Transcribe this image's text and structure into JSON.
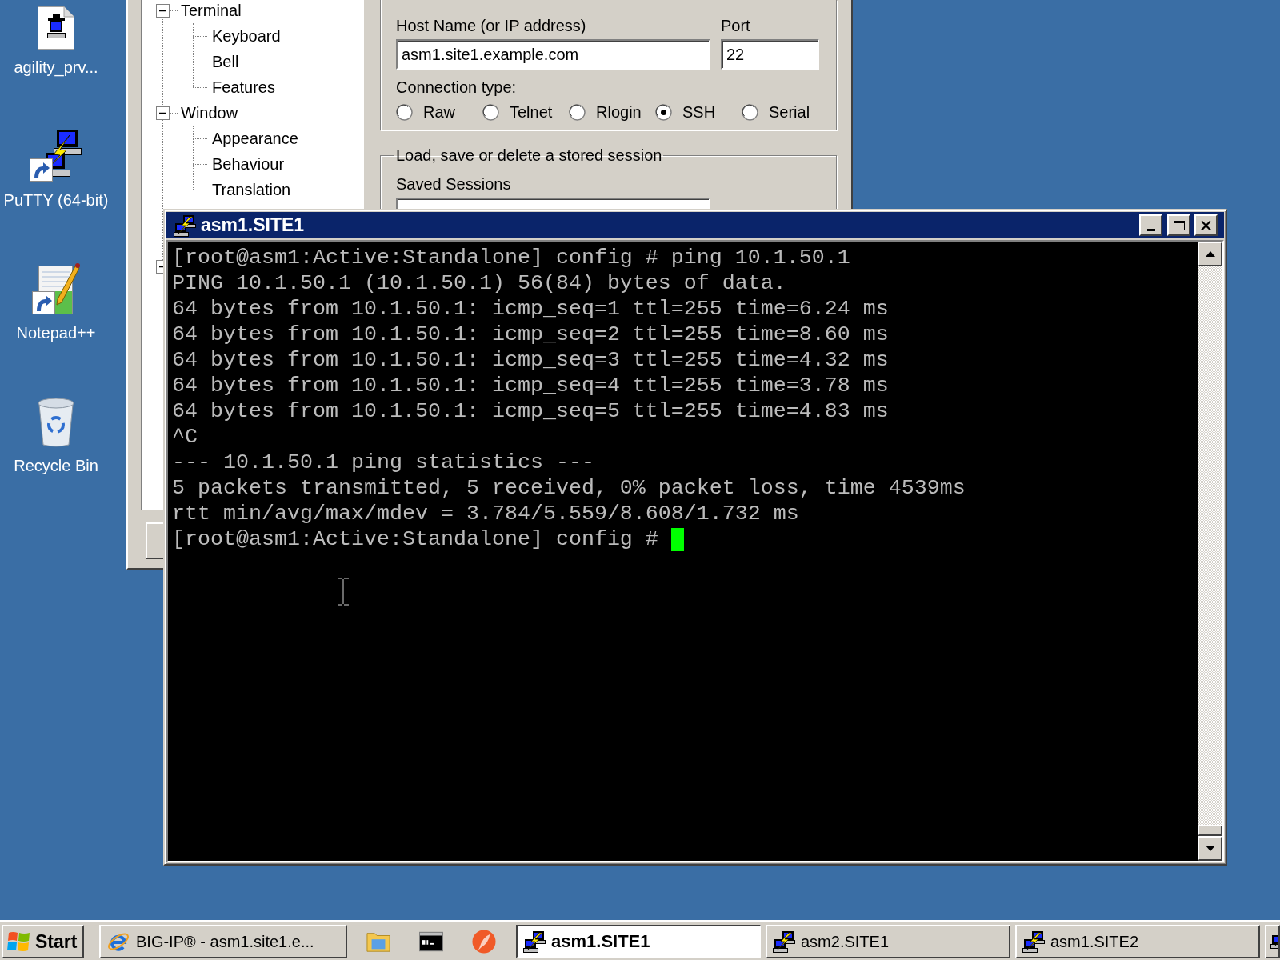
{
  "desktop_icons": [
    {
      "label": "agility_prv...",
      "kind": "document",
      "shortcut": false
    },
    {
      "label": "PuTTY (64-bit)",
      "kind": "terminal",
      "shortcut": true
    },
    {
      "label": "Notepad++",
      "kind": "editor",
      "shortcut": true
    },
    {
      "label": "Recycle Bin",
      "kind": "trash",
      "shortcut": false
    }
  ],
  "config_window": {
    "tree": [
      {
        "label": "Terminal",
        "expanded": true,
        "children": [
          {
            "label": "Keyboard"
          },
          {
            "label": "Bell"
          },
          {
            "label": "Features"
          }
        ]
      },
      {
        "label": "Window",
        "expanded": true,
        "children": [
          {
            "label": "Appearance"
          },
          {
            "label": "Behaviour"
          },
          {
            "label": "Translation"
          }
        ]
      },
      {
        "expanded": true
      }
    ],
    "host_label": "Host Name (or IP address)",
    "host_value": "asm1.site1.example.com",
    "port_label": "Port",
    "port_value": "22",
    "connection_type_label": "Connection type:",
    "connection_types": [
      {
        "label": "Raw",
        "selected": false
      },
      {
        "label": "Telnet",
        "selected": false
      },
      {
        "label": "Rlogin",
        "selected": false
      },
      {
        "label": "SSH",
        "selected": true
      },
      {
        "label": "Serial",
        "selected": false
      }
    ],
    "sessions_group_title": "Load, save or delete a stored session",
    "saved_sessions_label": "Saved Sessions"
  },
  "terminal_window": {
    "title": "asm1.SITE1",
    "lines": [
      "[root@asm1:Active:Standalone] config # ping 10.1.50.1",
      "PING 10.1.50.1 (10.1.50.1) 56(84) bytes of data.",
      "64 bytes from 10.1.50.1: icmp_seq=1 ttl=255 time=6.24 ms",
      "64 bytes from 10.1.50.1: icmp_seq=2 ttl=255 time=8.60 ms",
      "64 bytes from 10.1.50.1: icmp_seq=3 ttl=255 time=4.32 ms",
      "64 bytes from 10.1.50.1: icmp_seq=4 ttl=255 time=3.78 ms",
      "64 bytes from 10.1.50.1: icmp_seq=5 ttl=255 time=4.83 ms",
      "^C",
      "--- 10.1.50.1 ping statistics ---",
      "5 packets transmitted, 5 received, 0% packet loss, time 4539ms",
      "rtt min/avg/max/mdev = 3.784/5.559/8.608/1.732 ms",
      "[root@asm1:Active:Standalone] config #"
    ],
    "cursor_visible": true
  },
  "taskbar": {
    "start_label": "Start",
    "items": [
      {
        "kind": "browser",
        "label": "BIG-IP® - asm1.site1.e...",
        "selected": false
      },
      {
        "kind": "folder",
        "selected": false
      },
      {
        "kind": "console",
        "selected": false
      },
      {
        "kind": "tool",
        "selected": false
      },
      {
        "kind": "terminal",
        "label": "asm1.SITE1",
        "selected": true
      },
      {
        "kind": "terminal",
        "label": "asm2.SITE1",
        "selected": false
      },
      {
        "kind": "terminal",
        "label": "asm1.SITE2",
        "selected": false
      },
      {
        "kind": "terminal",
        "selected": false
      }
    ]
  }
}
